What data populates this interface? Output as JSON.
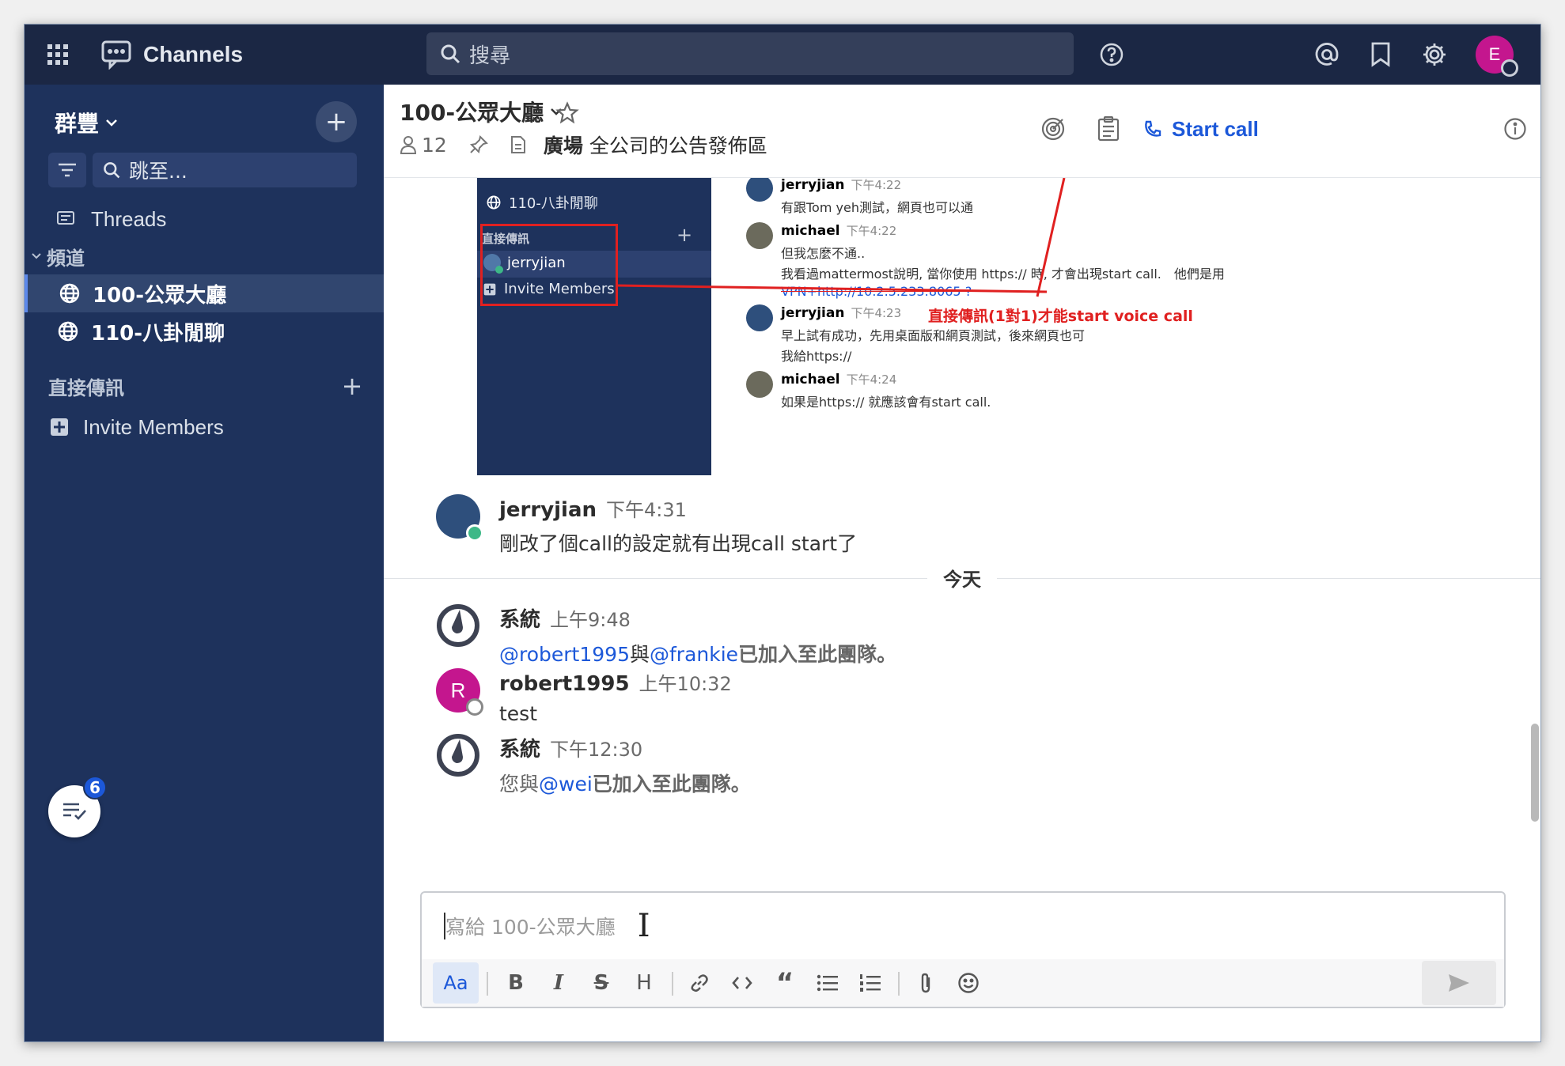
{
  "topbar": {
    "app_name": "Channels",
    "search_placeholder": "搜尋",
    "avatar_letter": "E"
  },
  "sidebar": {
    "team_name": "群豐",
    "jump_placeholder": "跳至...",
    "threads_label": "Threads",
    "channels_header": "頻道",
    "channels": [
      {
        "name": "100-公眾大廳",
        "active": true
      },
      {
        "name": "110-八卦閒聊",
        "active": false
      }
    ],
    "dm_header": "直接傳訊",
    "invite_label": "Invite Members",
    "badge_count": "6"
  },
  "channel_header": {
    "name": "100-公眾大廳",
    "member_count": "12",
    "purpose_bold": "廣場",
    "purpose": "全公司的公告發佈區",
    "start_call": "Start call"
  },
  "embedded_screenshot": {
    "sidebar_channel": "110-八卦閒聊",
    "dm_header": "直接傳訊",
    "dm_user": "jerryjian",
    "invite": "Invite Members",
    "annotation": "直接傳訊(1對1)才能start voice call",
    "messages": [
      {
        "user": "jerryjian",
        "time": "下午4:22",
        "lines": [
          "有跟Tom yeh測試，網頁也可以通"
        ]
      },
      {
        "user": "michael",
        "time": "下午4:22",
        "lines": [
          "但我怎麼不通..",
          "我看過mattermost說明, 當你使用 https:// 時, 才會出現start call.　他們是用",
          "VPN+http://10.2.5.233:8065 ?"
        ]
      },
      {
        "user": "jerryjian",
        "time": "下午4:23",
        "lines": [
          "早上試有成功，先用桌面版和網頁測試，後來網頁也可",
          "我給https://"
        ]
      },
      {
        "user": "michael",
        "time": "下午4:24",
        "lines": [
          "如果是https:// 就應該會有start call."
        ]
      }
    ]
  },
  "messages": [
    {
      "user": "jerryjian",
      "time": "下午4:31",
      "text": "剛改了個call的設定就有出現call start了"
    },
    {
      "user": "系統",
      "time": "上午9:48",
      "mention1": "@robert1995",
      "sep": "與",
      "mention2": "@frankie",
      "text": "已加入至此團隊。"
    },
    {
      "user": "robert1995",
      "time": "上午10:32",
      "text": "test",
      "avatar_letter": "R"
    },
    {
      "user": "系統",
      "time": "下午12:30",
      "prefix": "您與",
      "mention1": "@wei",
      "text": "已加入至此團隊。"
    }
  ],
  "date_separator": "今天",
  "composer": {
    "placeholder": "寫給 100-公眾大廳",
    "tools": [
      "Aa",
      "B",
      "I",
      "S",
      "H",
      "link",
      "code",
      "quote",
      "bullets",
      "numbered",
      "attach",
      "emoji"
    ]
  },
  "colors": {
    "topbar": "#1b2744",
    "sidebar": "#1e325c",
    "accent": "#1c58d9",
    "avatar_pink": "#c4168e",
    "annotation_red": "#e02020"
  }
}
